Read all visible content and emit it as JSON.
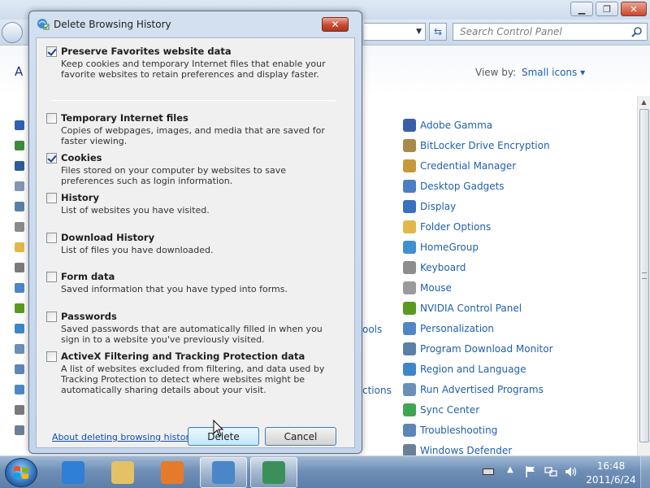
{
  "control_panel": {
    "search_placeholder": "Search Control Panel",
    "heading_fragment": "A",
    "view_by_label": "View by:",
    "view_by_value": "Small icons ▾",
    "mid_fragments": [
      "ools",
      "ctions"
    ],
    "items": [
      {
        "label": "Adobe Gamma",
        "icon": "adobe-gamma-icon",
        "color": "#3a5fa8"
      },
      {
        "label": "BitLocker Drive Encryption",
        "icon": "bitlocker-icon",
        "color": "#a88a4a"
      },
      {
        "label": "Credential Manager",
        "icon": "credential-manager-icon",
        "color": "#c59a3c"
      },
      {
        "label": "Desktop Gadgets",
        "icon": "desktop-gadgets-icon",
        "color": "#4a7fc1"
      },
      {
        "label": "Display",
        "icon": "display-icon",
        "color": "#3b6fbf"
      },
      {
        "label": "Folder Options",
        "icon": "folder-options-icon",
        "color": "#e2b84a"
      },
      {
        "label": "HomeGroup",
        "icon": "homegroup-icon",
        "color": "#3f8fd1"
      },
      {
        "label": "Keyboard",
        "icon": "keyboard-icon",
        "color": "#8d8d8d"
      },
      {
        "label": "Mouse",
        "icon": "mouse-icon",
        "color": "#9a9a9a"
      },
      {
        "label": "NVIDIA Control Panel",
        "icon": "nvidia-icon",
        "color": "#5a9a1e"
      },
      {
        "label": "Personalization",
        "icon": "personalization-icon",
        "color": "#4f87c4"
      },
      {
        "label": "Program Download Monitor",
        "icon": "program-download-monitor-icon",
        "color": "#5b7fa6"
      },
      {
        "label": "Region and Language",
        "icon": "region-language-icon",
        "color": "#3c87c9"
      },
      {
        "label": "Run Advertised Programs",
        "icon": "run-advertised-programs-icon",
        "color": "#6a8fb8"
      },
      {
        "label": "Sync Center",
        "icon": "sync-center-icon",
        "color": "#3fa552"
      },
      {
        "label": "Troubleshooting",
        "icon": "troubleshooting-icon",
        "color": "#5b86b5"
      },
      {
        "label": "Windows Defender",
        "icon": "windows-defender-icon",
        "color": "#6b7f99"
      }
    ]
  },
  "dialog": {
    "title": "Delete Browsing History",
    "close_label": "✕",
    "options": [
      {
        "title": "Preserve Favorites website data",
        "checked": true,
        "description": "Keep cookies and temporary Internet files that enable your favorite websites to retain preferences and display faster."
      },
      {
        "title": "Temporary Internet files",
        "checked": false,
        "description": "Copies of webpages, images, and media that are saved for faster viewing."
      },
      {
        "title": "Cookies",
        "checked": true,
        "description": "Files stored on your computer by websites to save preferences such as login information."
      },
      {
        "title": "History",
        "checked": false,
        "description": "List of websites you have visited."
      },
      {
        "title": "Download History",
        "checked": false,
        "description": "List of files you have downloaded."
      },
      {
        "title": "Form data",
        "checked": false,
        "description": "Saved information that you have typed into forms."
      },
      {
        "title": "Passwords",
        "checked": false,
        "description": "Saved passwords that are automatically filled in when you sign in to a website you've previously visited."
      },
      {
        "title": "ActiveX Filtering and Tracking Protection data",
        "checked": false,
        "description": "A list of websites excluded from filtering, and data used by Tracking Protection to detect where websites might be automatically sharing details about your visit."
      }
    ],
    "about_link": "About deleting browsing history",
    "delete_label": "Delete",
    "cancel_label": "Cancel"
  },
  "taskbar": {
    "clock_time": "16:48",
    "clock_date": "2011/6/24",
    "items": [
      {
        "icon": "internet-explorer-icon",
        "color": "#2f7fd6",
        "active": false
      },
      {
        "icon": "windows-explorer-icon",
        "color": "#e4c164",
        "active": false
      },
      {
        "icon": "media-player-icon",
        "color": "#e57b2a",
        "active": false
      },
      {
        "icon": "control-panel-icon",
        "color": "#4a86c8",
        "active": true
      },
      {
        "icon": "delete-history-icon",
        "color": "#3d8f5a",
        "active": true
      }
    ]
  }
}
